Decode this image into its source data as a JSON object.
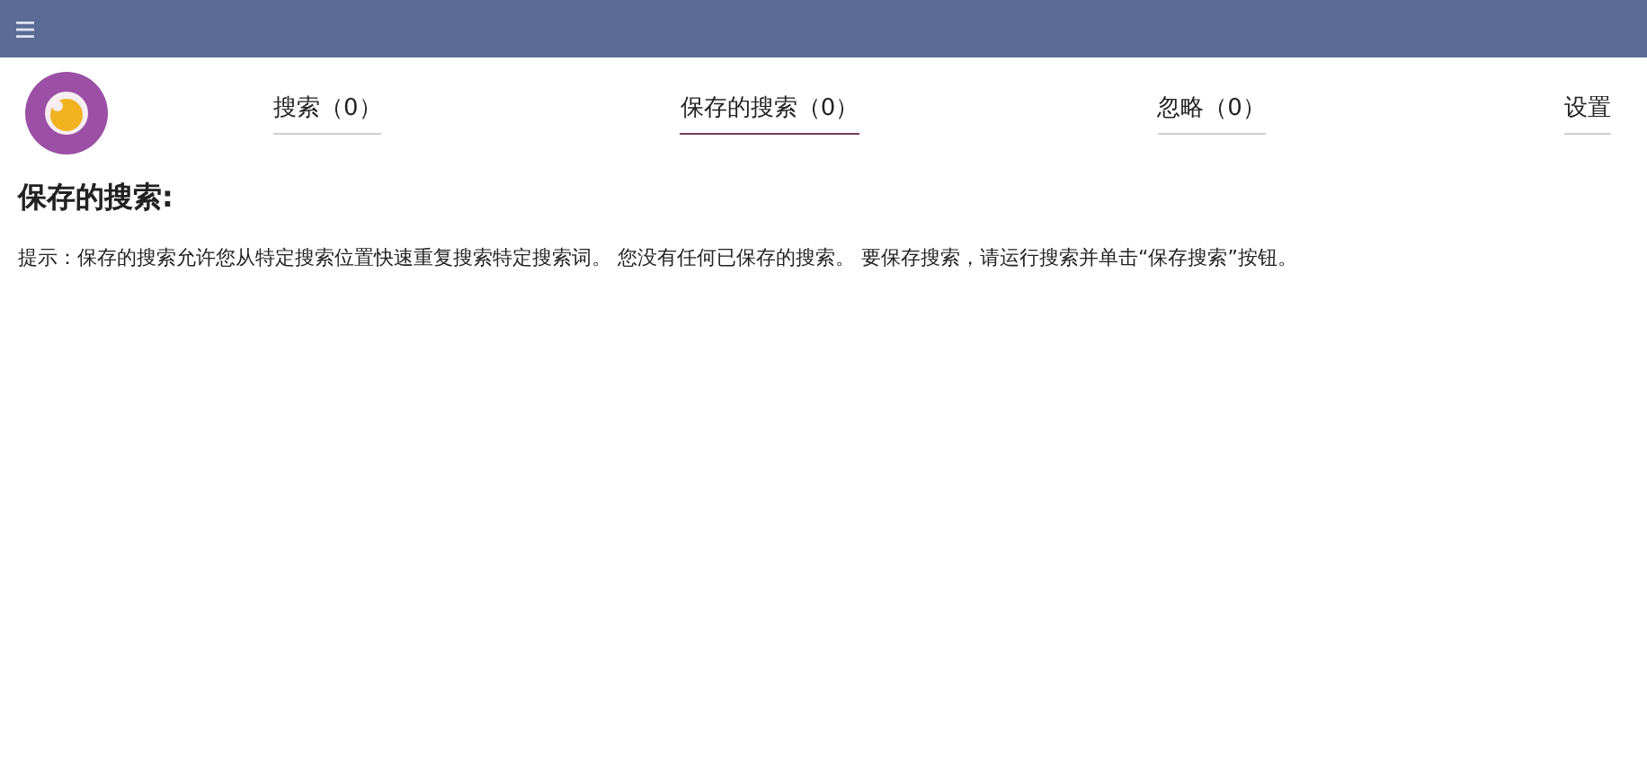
{
  "tabs": [
    {
      "label": "搜索（0）",
      "selected": false
    },
    {
      "label": "保存的搜索（0）",
      "selected": true
    },
    {
      "label": "忽略（0）",
      "selected": false
    },
    {
      "label": "设置",
      "selected": false
    }
  ],
  "heading": "保存的搜索:",
  "hint": "提示：保存的搜索允许您从特定搜索位置快速重复搜索特定搜索词。 您没有任何已保存的搜索。 要保存搜索，请运行搜索并单击“保存搜索”按钮。"
}
